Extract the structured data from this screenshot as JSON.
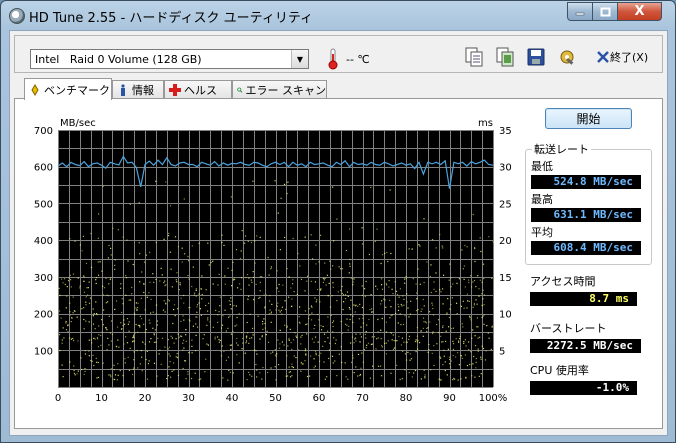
{
  "window": {
    "title": "HD Tune 2.55 - ハードディスク ユーティリティ",
    "close_glyph": "X"
  },
  "toolbar": {
    "drive": "Intel   Raid 0 Volume (128 GB)",
    "temperature": "-- ℃",
    "exit_label": "終了(X)",
    "icons": [
      "copy-text-icon",
      "copy-screenshot-icon",
      "save-icon",
      "options-icon"
    ]
  },
  "tabs": [
    {
      "label": "ベンチマーク",
      "icon": "benchmark-icon",
      "active": true
    },
    {
      "label": "情報",
      "icon": "info-icon",
      "active": false
    },
    {
      "label": "ヘルス",
      "icon": "health-icon",
      "active": false
    },
    {
      "label": "エラー スキャン",
      "icon": "error-scan-icon",
      "active": false
    }
  ],
  "benchmark": {
    "start_label": "開始",
    "transfer_rate": {
      "title": "転送レート",
      "min_label": "最低",
      "min_value": "524.8 MB/sec",
      "max_label": "最高",
      "max_value": "631.1 MB/sec",
      "avg_label": "平均",
      "avg_value": "608.4 MB/sec"
    },
    "access_time": {
      "label": "アクセス時間",
      "value": "8.7 ms"
    },
    "burst_rate": {
      "label": "バーストレート",
      "value": "2272.5 MB/sec"
    },
    "cpu_usage": {
      "label": "CPU 使用率",
      "value": "-1.0%"
    }
  },
  "colors": {
    "plot_bg": "#000000",
    "grid": "#808080",
    "line": "#4aa3df",
    "dots": "#e6e66a",
    "accent": "#6fb9ff"
  },
  "chart_data": {
    "type": "line",
    "y_left": {
      "label": "MB/sec",
      "ticks": [
        700,
        600,
        500,
        400,
        300,
        200,
        100
      ],
      "range": [
        0,
        700
      ]
    },
    "y_right": {
      "label": "ms",
      "ticks": [
        35,
        30,
        25,
        20,
        15,
        10,
        5
      ],
      "range": [
        0,
        35
      ]
    },
    "x": {
      "ticks": [
        "0",
        "10",
        "20",
        "30",
        "40",
        "50",
        "60",
        "70",
        "80",
        "90",
        "100%"
      ],
      "range": [
        0,
        100
      ]
    },
    "transfer_series": {
      "x": [
        0,
        1,
        2,
        3,
        4,
        5,
        6,
        7,
        8,
        9,
        10,
        11,
        12,
        13,
        14,
        15,
        16,
        17,
        18,
        19,
        20,
        21,
        22,
        23,
        24,
        25,
        26,
        27,
        28,
        29,
        30,
        31,
        32,
        33,
        34,
        35,
        36,
        37,
        38,
        39,
        40,
        41,
        42,
        43,
        44,
        45,
        46,
        47,
        48,
        49,
        50,
        51,
        52,
        53,
        54,
        55,
        56,
        57,
        58,
        59,
        60,
        61,
        62,
        63,
        64,
        65,
        66,
        67,
        68,
        69,
        70,
        71,
        72,
        73,
        74,
        75,
        76,
        77,
        78,
        79,
        80,
        81,
        82,
        83,
        84,
        85,
        86,
        87,
        88,
        89,
        90,
        91,
        92,
        93,
        94,
        95,
        96,
        97,
        98,
        99,
        100
      ],
      "y": [
        602,
        610,
        600,
        612,
        606,
        603,
        614,
        600,
        608,
        610,
        604,
        596,
        612,
        608,
        605,
        628,
        610,
        612,
        598,
        545,
        606,
        615,
        604,
        618,
        606,
        624,
        606,
        602,
        610,
        612,
        606,
        606,
        600,
        612,
        608,
        604,
        614,
        602,
        610,
        604,
        609,
        608,
        612,
        606,
        604,
        612,
        610,
        604,
        600,
        608,
        612,
        606,
        612,
        600,
        612,
        604,
        608,
        600,
        612,
        606,
        608,
        610,
        604,
        600,
        612,
        606,
        616,
        600,
        612,
        606,
        608,
        604,
        612,
        606,
        604,
        612,
        608,
        602,
        606,
        610,
        604,
        608,
        595,
        612,
        580,
        612,
        608,
        612,
        606,
        616,
        540,
        612,
        608,
        612,
        602,
        614,
        608,
        612,
        618,
        606,
        604
      ]
    },
    "access_scatter_note": "Yellow dots show random access times, concentrated between 1 and 20 ms."
  }
}
